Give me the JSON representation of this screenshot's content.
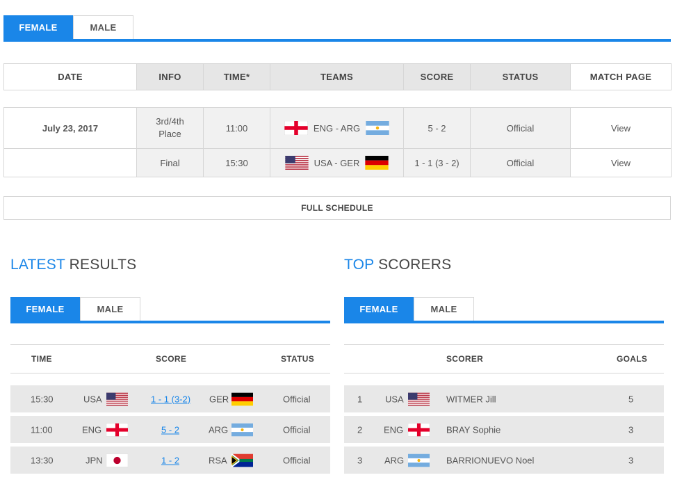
{
  "main_tabs": [
    "FEMALE",
    "MALE"
  ],
  "schedule": {
    "headers": [
      "DATE",
      "INFO",
      "TIME*",
      "TEAMS",
      "SCORE",
      "STATUS",
      "MATCH PAGE"
    ],
    "date": "July 23, 2017",
    "rows": [
      {
        "info": "3rd/4th Place",
        "time": "11:00",
        "teams": "ENG - ARG",
        "flag1": "england-flag-icon",
        "flag2": "argentina-flag-icon",
        "score": "5 - 2",
        "status": "Official",
        "link": "View"
      },
      {
        "info": "Final",
        "time": "15:30",
        "teams": "USA - GER",
        "flag1": "usa-flag-icon",
        "flag2": "germany-flag-icon",
        "score": "1 - 1 (3 - 2)",
        "status": "Official",
        "link": "View"
      }
    ],
    "full_schedule": "FULL SCHEDULE"
  },
  "latest": {
    "title_highlight": "LATEST",
    "title_rest": "RESULTS",
    "tabs": [
      "FEMALE",
      "MALE"
    ],
    "headers": [
      "TIME",
      "SCORE",
      "STATUS"
    ],
    "rows": [
      {
        "time": "15:30",
        "home": "USA",
        "score": "1 - 1 (3-2)",
        "away": "GER",
        "status": "Official"
      },
      {
        "time": "11:00",
        "home": "ENG",
        "score": "5 - 2",
        "away": "ARG",
        "status": "Official"
      },
      {
        "time": "13:30",
        "home": "JPN",
        "score": "1 - 2",
        "away": "RSA",
        "status": "Official"
      }
    ]
  },
  "scorers": {
    "title_highlight": "TOP",
    "title_rest": "SCORERS",
    "tabs": [
      "FEMALE",
      "MALE"
    ],
    "headers": [
      "SCORER",
      "GOALS"
    ],
    "rows": [
      {
        "rank": "1",
        "country": "USA",
        "name": "WITMER Jill",
        "goals": "5"
      },
      {
        "rank": "2",
        "country": "ENG",
        "name": "BRAY Sophie",
        "goals": "3"
      },
      {
        "rank": "3",
        "country": "ARG",
        "name": "BARRIONUEVO Noel",
        "goals": "3"
      }
    ]
  },
  "colors": {
    "accent": "#1a86e8",
    "row_bg": "#e8e8e8",
    "header_bg": "#e6e6e6"
  }
}
